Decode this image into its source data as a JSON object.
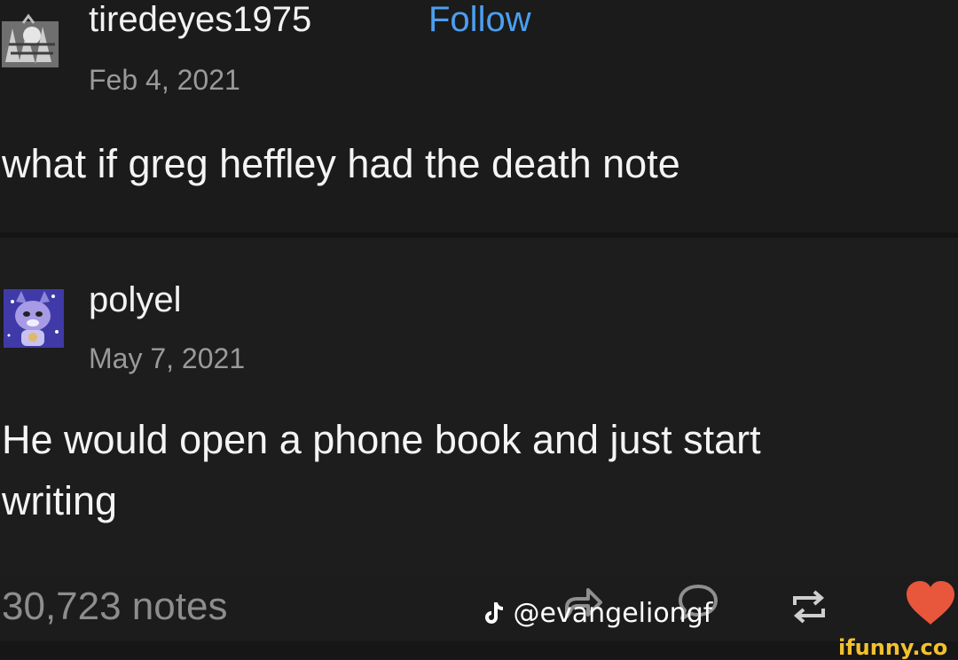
{
  "post1": {
    "username": "tiredeyes1975",
    "follow_label": "Follow",
    "date": "Feb 4, 2021",
    "text": "what if greg heffley had the death note"
  },
  "post2": {
    "username": "polyel",
    "date": "May 7, 2021",
    "text_line1": "He would open a phone book and just start",
    "text_line2": "writing"
  },
  "footer": {
    "notes": "30,723 notes",
    "watermark_handle": "@evangeliongf",
    "icons": [
      "share-icon",
      "reply-icon",
      "reblog-icon",
      "heart-icon"
    ]
  },
  "brand": {
    "ifunny": "ifunny.co",
    "ifunny_color": "#f2c12e"
  },
  "colors": {
    "background": "#1c1c1c",
    "follow": "#4b9ff0",
    "heart": "#e8563c",
    "muted": "#9a9a9a"
  }
}
